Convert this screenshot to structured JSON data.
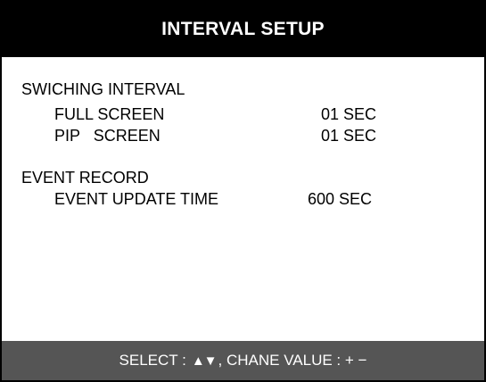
{
  "header": {
    "title": "INTERVAL SETUP"
  },
  "switching": {
    "section_label": "SWICHING INTERVAL",
    "rows": [
      {
        "label": "FULL SCREEN",
        "value": "01 SEC"
      },
      {
        "label": "PIP   SCREEN",
        "value": "01 SEC"
      }
    ]
  },
  "event": {
    "section_label": "EVENT RECORD",
    "rows": [
      {
        "label": "EVENT UPDATE TIME",
        "value": "600 SEC"
      }
    ]
  },
  "footer": {
    "select_label": "SELECT :",
    "arrows": "▲▼",
    "change_label": ", CHANE VALUE : + −"
  }
}
